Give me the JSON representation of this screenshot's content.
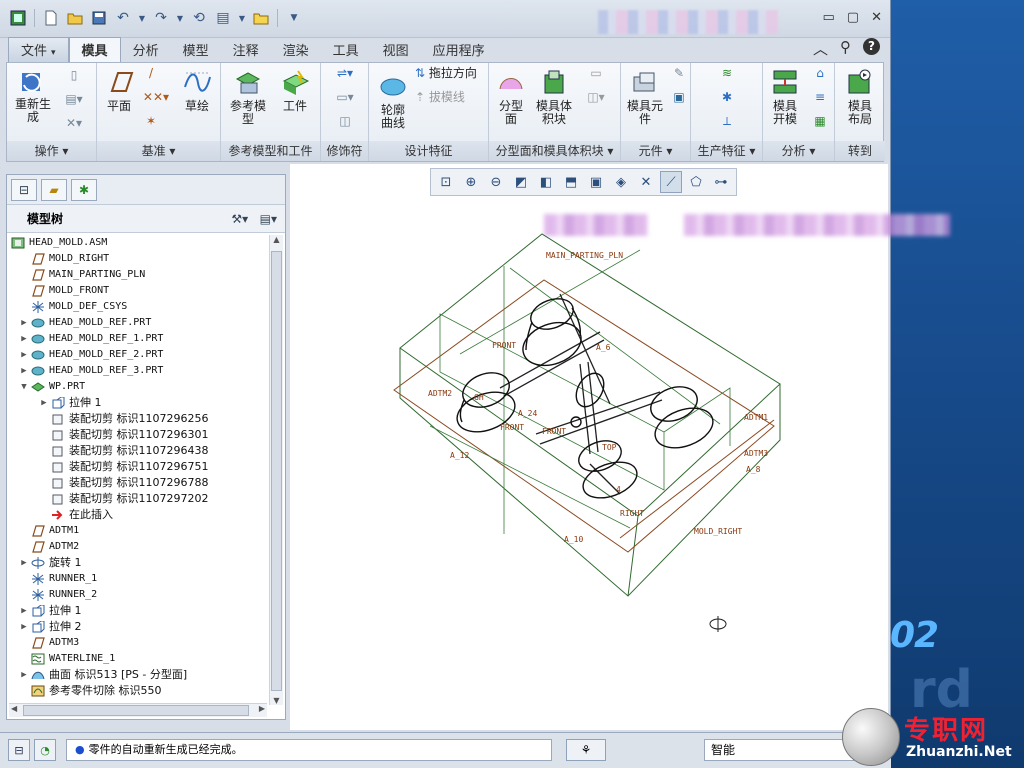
{
  "qat": {
    "icons": [
      "app-icon",
      "new-icon",
      "open-icon",
      "save-icon",
      "undo-icon",
      "redo-icon",
      "regenerate-icon",
      "window-icon",
      "folder-icon"
    ]
  },
  "window_controls": {
    "minimize": "▭",
    "maximize": "▢",
    "close": "✕"
  },
  "tabs": [
    {
      "label": "文件",
      "name": "tab-file"
    },
    {
      "label": "模具",
      "name": "tab-mold"
    },
    {
      "label": "分析",
      "name": "tab-analysis"
    },
    {
      "label": "模型",
      "name": "tab-model"
    },
    {
      "label": "注释",
      "name": "tab-annotate"
    },
    {
      "label": "渲染",
      "name": "tab-render"
    },
    {
      "label": "工具",
      "name": "tab-tools"
    },
    {
      "label": "视图",
      "name": "tab-view"
    },
    {
      "label": "应用程序",
      "name": "tab-applications"
    }
  ],
  "ribbon": {
    "groups": {
      "operations": "操作",
      "datum": "基准",
      "ref_model": "参考模型和工件",
      "modifiers": "修饰符",
      "design": "设计特征",
      "parting": "分型面和模具体积块",
      "components": "元件",
      "production": "生产特征",
      "analysis": "分析",
      "goto": "转到"
    },
    "buttons": {
      "regenerate": "重新生\n成",
      "plane": "平面",
      "sketch": "草绘",
      "ref_model": "参考模\n型",
      "workpiece": "工件",
      "profile_curve": "轮廓\n曲线",
      "drag_direction": "拖拉方向",
      "draft_line": "拔模线",
      "parting_surface": "分型\n面",
      "mold_volume": "模具体\n积块",
      "mold_component": "模具元\n件",
      "mold_open": "模具\n开模",
      "mold_layout": "模具\n布局"
    }
  },
  "model_tree": {
    "title": "模型树",
    "rows": [
      {
        "level": 0,
        "expand": "",
        "icon": "asm",
        "text": "HEAD_MOLD.ASM"
      },
      {
        "level": 1,
        "expand": "",
        "icon": "plane",
        "text": "MOLD_RIGHT"
      },
      {
        "level": 1,
        "expand": "",
        "icon": "plane",
        "text": "MAIN_PARTING_PLN"
      },
      {
        "level": 1,
        "expand": "",
        "icon": "plane",
        "text": "MOLD_FRONT"
      },
      {
        "level": 1,
        "expand": "",
        "icon": "csys",
        "text": "MOLD_DEF_CSYS"
      },
      {
        "level": 1,
        "expand": "▶",
        "icon": "part",
        "text": "HEAD_MOLD_REF.PRT"
      },
      {
        "level": 1,
        "expand": "▶",
        "icon": "part",
        "text": "HEAD_MOLD_REF_1.PRT"
      },
      {
        "level": 1,
        "expand": "▶",
        "icon": "part",
        "text": "HEAD_MOLD_REF_2.PRT"
      },
      {
        "level": 1,
        "expand": "▶",
        "icon": "part",
        "text": "HEAD_MOLD_REF_3.PRT"
      },
      {
        "level": 1,
        "expand": "▼",
        "icon": "wp",
        "text": "WP.PRT"
      },
      {
        "level": 2,
        "expand": "▶",
        "icon": "extrude",
        "text": "拉伸 1",
        "cn": true
      },
      {
        "level": 2,
        "expand": "",
        "icon": "cut",
        "text": "装配切剪 标识1107296256",
        "cn": true
      },
      {
        "level": 2,
        "expand": "",
        "icon": "cut",
        "text": "装配切剪 标识1107296301",
        "cn": true
      },
      {
        "level": 2,
        "expand": "",
        "icon": "cut",
        "text": "装配切剪 标识1107296438",
        "cn": true
      },
      {
        "level": 2,
        "expand": "",
        "icon": "cut",
        "text": "装配切剪 标识1107296751",
        "cn": true
      },
      {
        "level": 2,
        "expand": "",
        "icon": "cut",
        "text": "装配切剪 标识1107296788",
        "cn": true
      },
      {
        "level": 2,
        "expand": "",
        "icon": "cut",
        "text": "装配切剪 标识1107297202",
        "cn": true
      },
      {
        "level": 2,
        "expand": "",
        "icon": "insert",
        "text": "在此插入",
        "cn": true
      },
      {
        "level": 1,
        "expand": "",
        "icon": "plane",
        "text": "ADTM1"
      },
      {
        "level": 1,
        "expand": "",
        "icon": "plane",
        "text": "ADTM2"
      },
      {
        "level": 1,
        "expand": "▶",
        "icon": "revolve",
        "text": "旋转 1",
        "cn": true
      },
      {
        "level": 1,
        "expand": "",
        "icon": "csys",
        "text": "RUNNER_1"
      },
      {
        "level": 1,
        "expand": "",
        "icon": "csys",
        "text": "RUNNER_2"
      },
      {
        "level": 1,
        "expand": "▶",
        "icon": "extrude",
        "text": "拉伸 1",
        "cn": true
      },
      {
        "level": 1,
        "expand": "▶",
        "icon": "extrude",
        "text": "拉伸 2",
        "cn": true
      },
      {
        "level": 1,
        "expand": "",
        "icon": "plane",
        "text": "ADTM3"
      },
      {
        "level": 1,
        "expand": "",
        "icon": "waterline",
        "text": "WATERLINE_1"
      },
      {
        "level": 1,
        "expand": "▶",
        "icon": "surface",
        "text": "曲面 标识513 [PS - 分型面]",
        "cn": true
      },
      {
        "level": 1,
        "expand": "",
        "icon": "refcut",
        "text": "参考零件切除 标识550",
        "cn": true
      }
    ]
  },
  "graphics": {
    "labels": {
      "main_parting": "MAIN_PARTING_PLN",
      "front": "FRONT",
      "front2": "FRONT",
      "adtm1": "ADTM1",
      "adtm2": "ADTM2",
      "adtm3": "ADTM3",
      "mold_right": "MOLD_RIGHT",
      "top": "TOP",
      "right": "RIGHT",
      "a12": "A_12",
      "a10": "A_10",
      "a8": "A_8",
      "a24": "A_24",
      "a6": "A_6",
      "c4": "4"
    }
  },
  "status": {
    "message": "零件的自动重新生成已经完成。",
    "filter": "智能"
  },
  "watermark": {
    "zh": "专职网",
    "en": "Zhuanzhi.Net",
    "desktop_num": "02"
  }
}
